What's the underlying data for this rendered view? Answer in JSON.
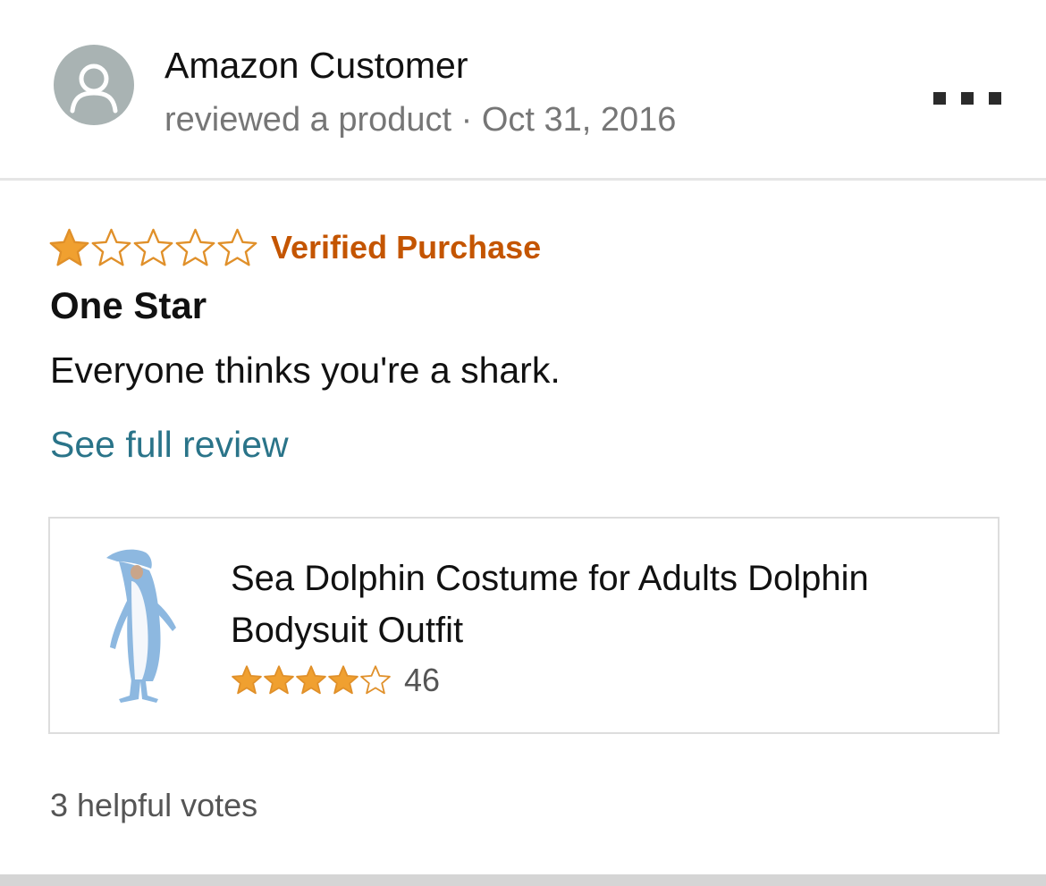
{
  "review": {
    "author": "Amazon Customer",
    "meta": "reviewed a product · Oct 31, 2016",
    "rating": 1,
    "rating_max": 5,
    "verified_label": "Verified Purchase",
    "title": "One Star",
    "body": "Everyone thinks you're a shark.",
    "see_full_label": "See full review",
    "helpful_votes": "3 helpful votes"
  },
  "product": {
    "title": "Sea Dolphin Costume for Adults Dolphin Bodysuit Outfit",
    "rating": 4,
    "rating_max": 5,
    "rating_count": "46"
  },
  "icons": {
    "avatar": "user-silhouette-icon",
    "more": "more-options-icon",
    "star": "star-icon"
  },
  "colors": {
    "star_fill": "#f0a030",
    "star_outline": "#e0902a",
    "verified": "#c45500",
    "link": "#2a7489"
  }
}
